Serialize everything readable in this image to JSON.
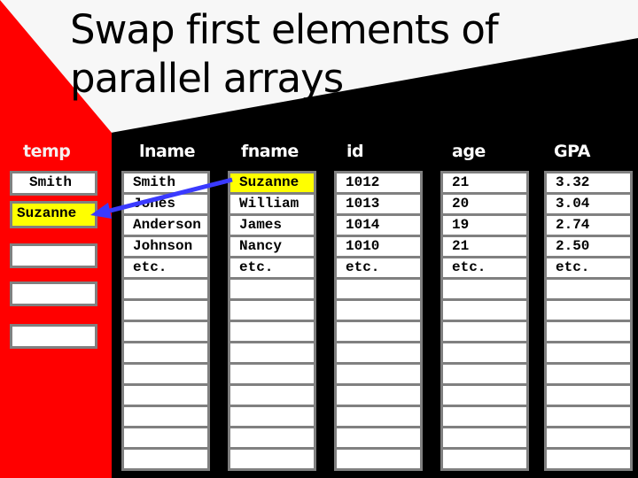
{
  "slide": {
    "title": "Swap first elements of parallel arrays",
    "colors": {
      "red_panel": "#ff0000",
      "light_panel": "#f7f7f7",
      "background": "#000000",
      "highlight": "#ffff00",
      "arrow": "#3a3aff",
      "cell_border": "#808080"
    }
  },
  "temp": {
    "label": "temp",
    "boxes": [
      "Smith",
      "Suzanne",
      "",
      ""
    ],
    "highlighted_index": 1
  },
  "arrays": [
    {
      "label": "lname",
      "values": [
        "Smith",
        "Jones",
        "Anderson",
        "Johnson",
        "etc.",
        "",
        "",
        "",
        "",
        "",
        "",
        "",
        "",
        ""
      ]
    },
    {
      "label": "fname",
      "values": [
        "Suzanne",
        "William",
        "James",
        "Nancy",
        "etc.",
        "",
        "",
        "",
        "",
        "",
        "",
        "",
        "",
        ""
      ],
      "highlighted_index": 0
    },
    {
      "label": "id",
      "values": [
        "1012",
        "1013",
        "1014",
        "1010",
        "etc.",
        "",
        "",
        "",
        "",
        "",
        "",
        "",
        "",
        ""
      ]
    },
    {
      "label": "age",
      "values": [
        "21",
        "20",
        "19",
        "21",
        "etc.",
        "",
        "",
        "",
        "",
        "",
        "",
        "",
        "",
        ""
      ]
    },
    {
      "label": "GPA",
      "values": [
        "3.32",
        "3.04",
        "2.74",
        "2.50",
        "etc.",
        "",
        "",
        "",
        "",
        "",
        "",
        "",
        "",
        ""
      ]
    }
  ],
  "arrow": {
    "from": "fname[0]",
    "to": "temp[1]",
    "meaning": "copy Suzanne into temp"
  }
}
